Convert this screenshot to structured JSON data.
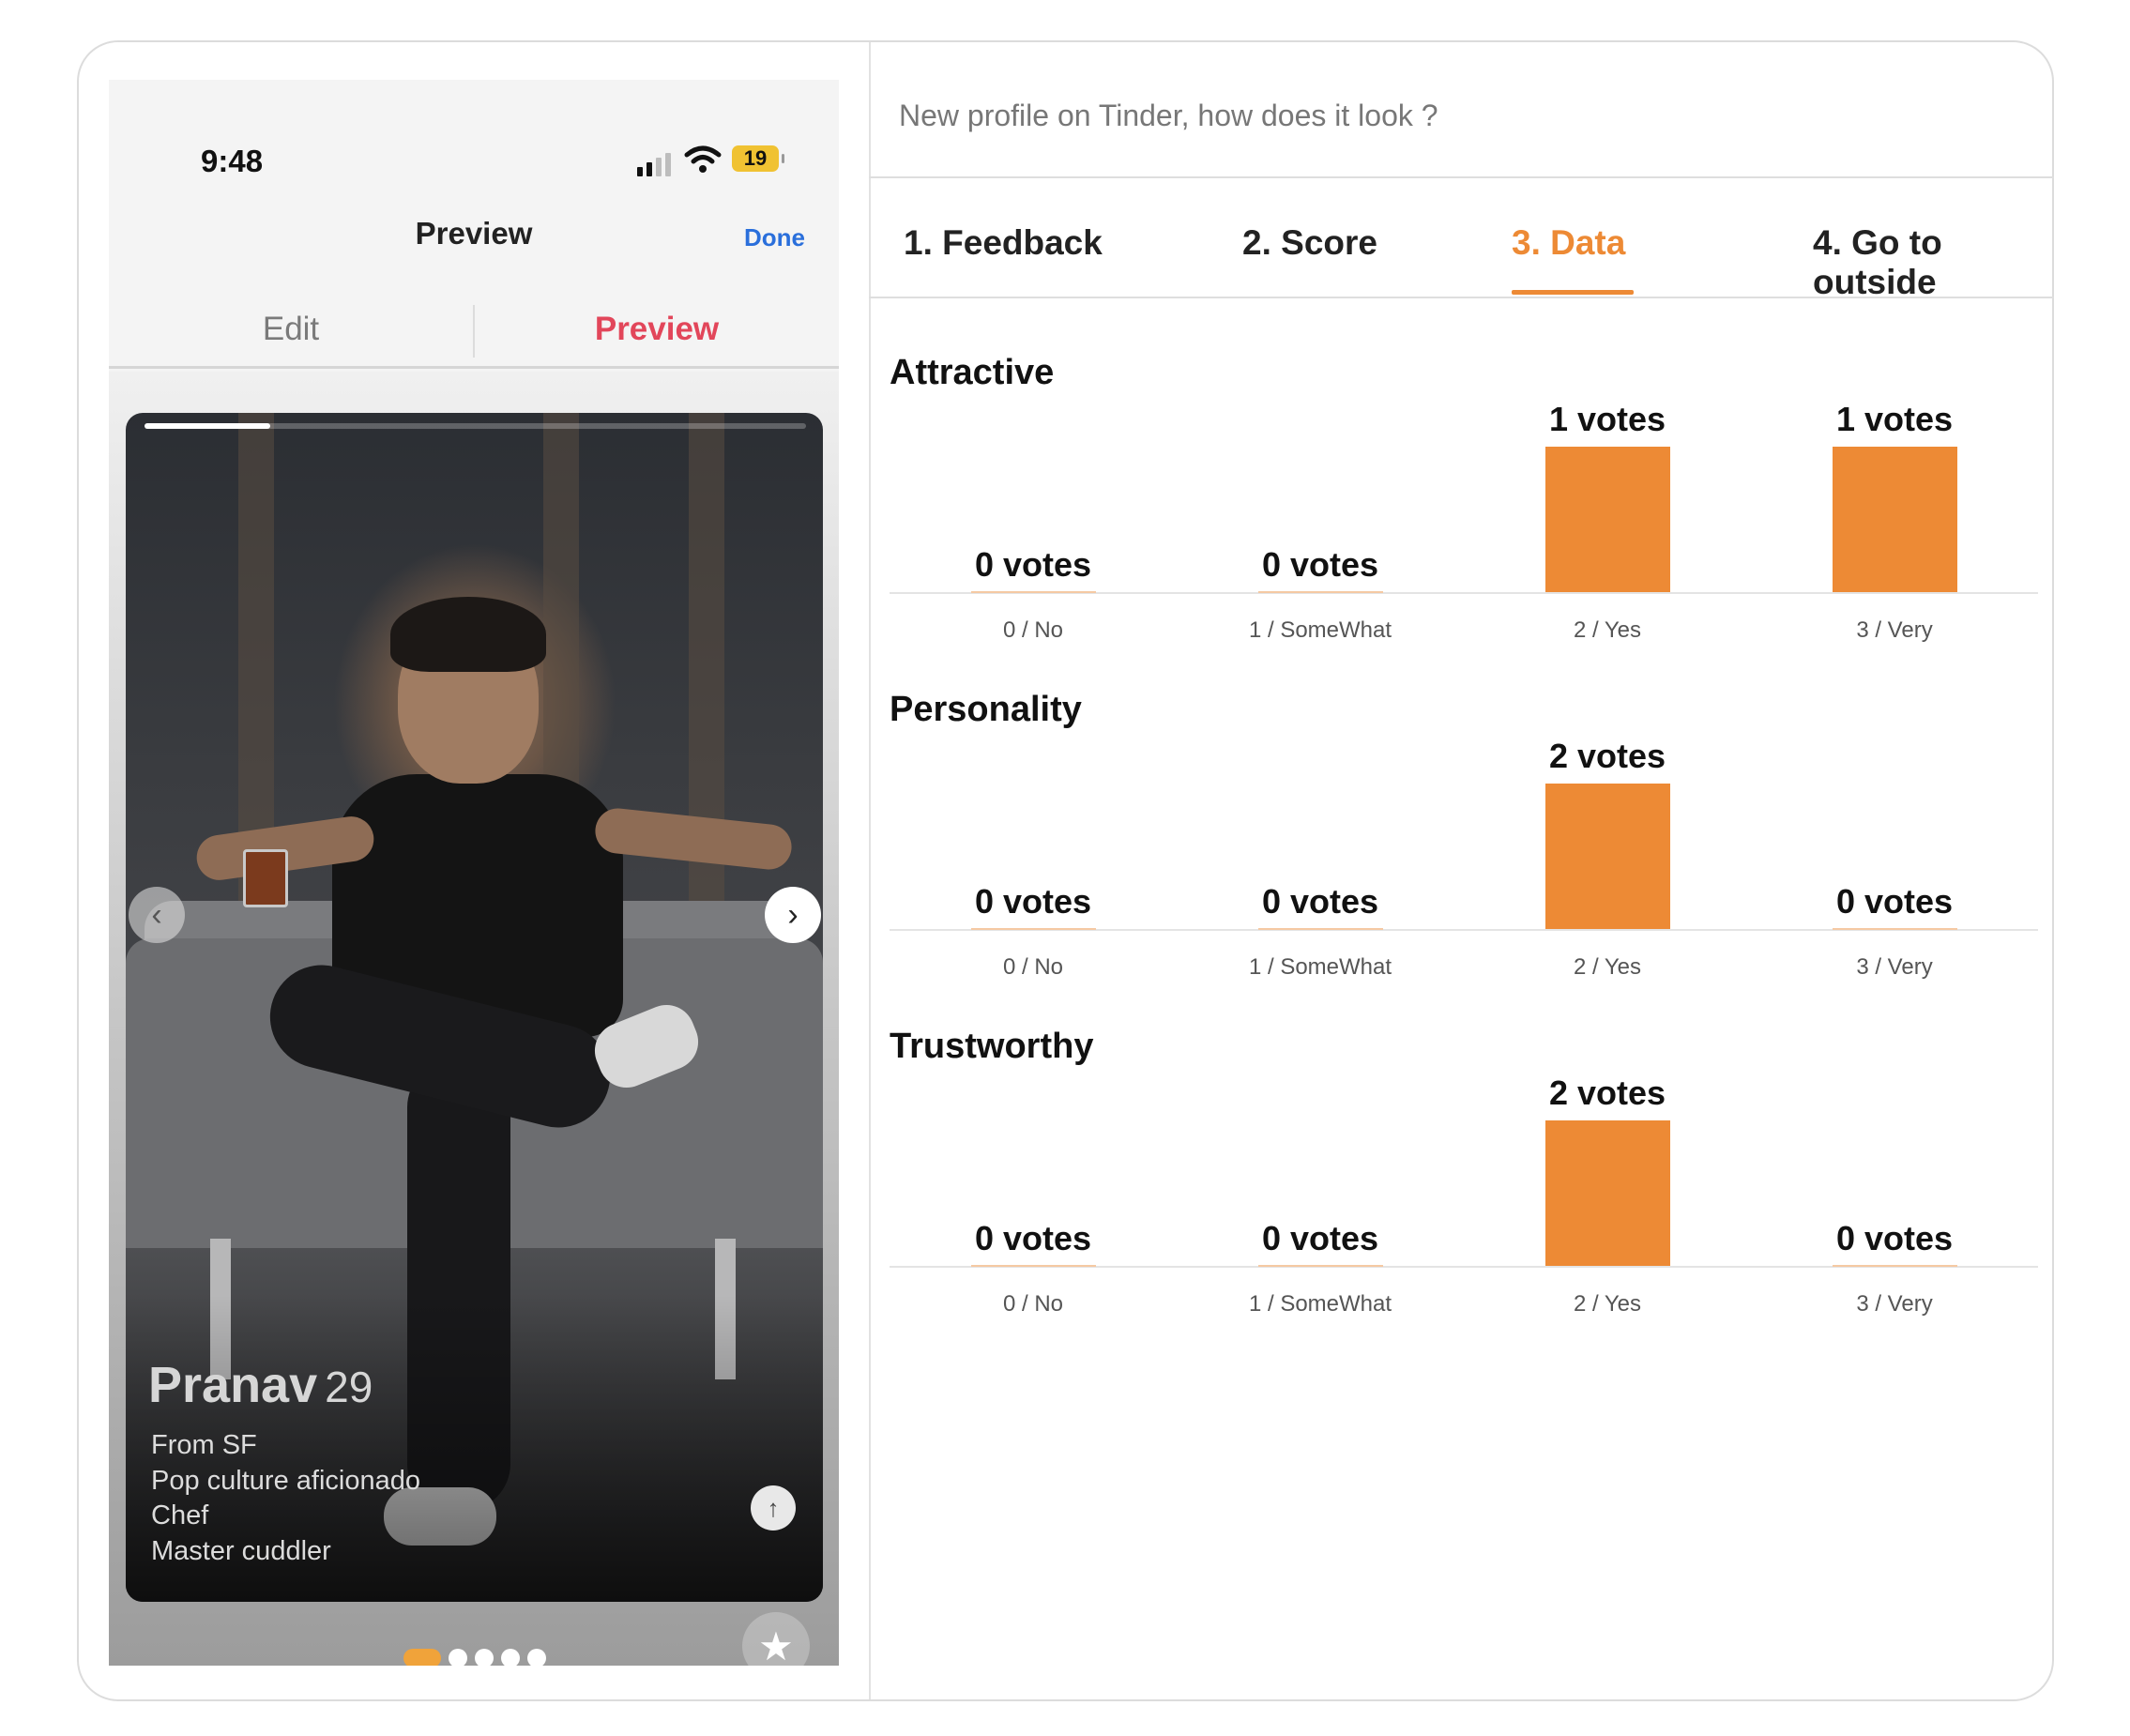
{
  "phone": {
    "status_time": "9:48",
    "battery": "19",
    "nav_title": "Preview",
    "nav_done": "Done",
    "segment": {
      "edit": "Edit",
      "preview": "Preview"
    },
    "photo_progress": 0.19,
    "profile": {
      "name": "Pranav",
      "age": "29",
      "lines": [
        "From SF",
        "Pop culture aficionado",
        "Chef",
        "Master cuddler"
      ]
    },
    "photo_index": 1,
    "photo_count": 5,
    "icons": {
      "prev": "chevron-left-icon",
      "next": "chevron-right-icon",
      "info": "arrow-up-icon",
      "superlike": "star-icon",
      "wifi": "wifi-icon",
      "signal": "signal-icon"
    }
  },
  "post": {
    "title": "New profile on Tinder, how does it look ?"
  },
  "tabs": [
    {
      "label": "1. Feedback",
      "active": false
    },
    {
      "label": "2. Score",
      "active": false
    },
    {
      "label": "3. Data",
      "active": true
    },
    {
      "label": "4. Go to outside",
      "active": false
    }
  ],
  "colors": {
    "accent": "#ed8a35",
    "preview_red": "#e2465a",
    "done_blue": "#2a6fdb"
  },
  "chart_data": [
    {
      "type": "bar",
      "title": "Attractive",
      "categories": [
        "0 / No",
        "1 / SomeWhat",
        "2 / Yes",
        "3 / Very"
      ],
      "values": [
        0,
        0,
        1,
        1
      ],
      "labels": [
        "0 votes",
        "0 votes",
        "1 votes",
        "1 votes"
      ],
      "ylim": [
        0,
        1
      ]
    },
    {
      "type": "bar",
      "title": "Personality",
      "categories": [
        "0 / No",
        "1 / SomeWhat",
        "2 / Yes",
        "3 / Very"
      ],
      "values": [
        0,
        0,
        2,
        0
      ],
      "labels": [
        "0 votes",
        "0 votes",
        "2 votes",
        "0 votes"
      ],
      "ylim": [
        0,
        2
      ]
    },
    {
      "type": "bar",
      "title": "Trustworthy",
      "categories": [
        "0 / No",
        "1 / SomeWhat",
        "2 / Yes",
        "3 / Very"
      ],
      "values": [
        0,
        0,
        2,
        0
      ],
      "labels": [
        "0 votes",
        "0 votes",
        "2 votes",
        "0 votes"
      ],
      "ylim": [
        0,
        2
      ]
    }
  ]
}
